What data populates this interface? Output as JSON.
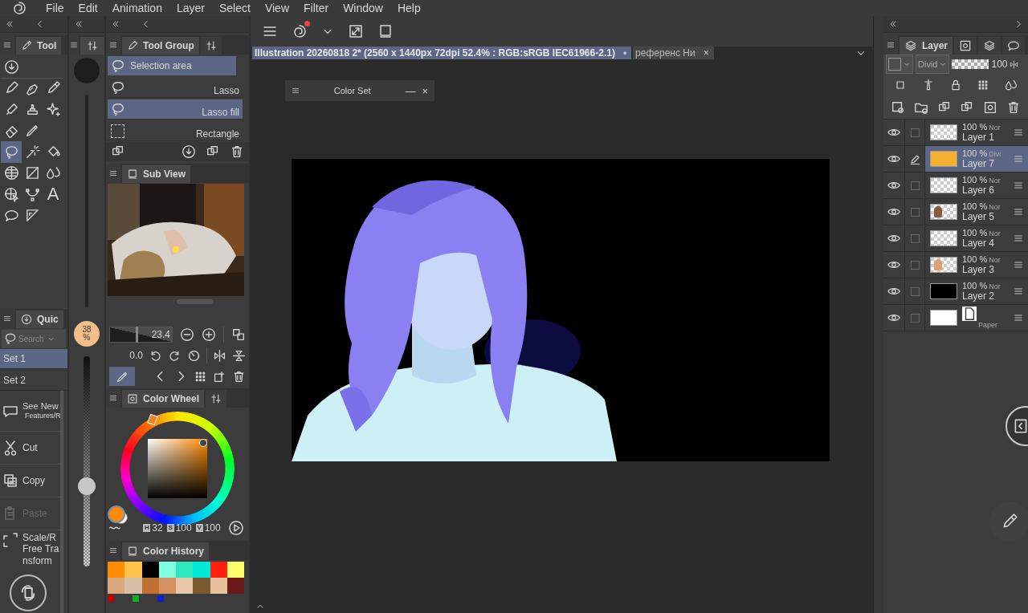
{
  "menu": [
    "File",
    "Edit",
    "Animation",
    "Layer",
    "Select",
    "View",
    "Filter",
    "Window",
    "Help"
  ],
  "tool_panel": {
    "tab": "Tool",
    "tools": [
      {
        "kind": "subtool",
        "selected": false
      },
      {
        "kind": "pen",
        "selected": false
      },
      {
        "kind": "nib",
        "selected": false
      },
      {
        "kind": "pencil",
        "selected": false
      },
      {
        "kind": "marker",
        "selected": false
      },
      {
        "kind": "stamp",
        "selected": false
      },
      {
        "kind": "sparkle",
        "selected": false
      },
      {
        "kind": "eraser",
        "selected": false
      },
      {
        "kind": "dropper",
        "selected": false
      },
      {
        "kind": "lasso",
        "selected": true
      },
      {
        "kind": "wand",
        "selected": false
      },
      {
        "kind": "bucket",
        "selected": false
      },
      {
        "kind": "grid",
        "selected": false
      },
      {
        "kind": "gradient",
        "selected": false
      },
      {
        "kind": "drops",
        "selected": false
      },
      {
        "kind": "cursor",
        "selected": false
      },
      {
        "kind": "bezier",
        "selected": false
      },
      {
        "kind": "text",
        "label": "A",
        "selected": false
      },
      {
        "kind": "bubble",
        "selected": false
      },
      {
        "kind": "ruler",
        "selected": false
      }
    ]
  },
  "brush_panel": {
    "badge_value": "38",
    "badge_unit": "%",
    "level": 0.37
  },
  "tool_group": {
    "tab": "Tool Group",
    "group": "Selection area",
    "items": [
      {
        "label": "Lasso",
        "selected": false
      },
      {
        "label": "Lasso fill",
        "selected": true
      },
      {
        "label": "Rectangle",
        "kind": "rect",
        "selected": false
      }
    ]
  },
  "sub_view": {
    "tab": "Sub View",
    "kind": "picture",
    "zoom": "23.4",
    "level": 0.42,
    "rotation": "0.0"
  },
  "quick_access": {
    "tab": "Quic",
    "search_placeholder": "Search",
    "sets": [
      {
        "label": "Set 1",
        "selected": true
      },
      {
        "label": "Set 2",
        "selected": false
      }
    ],
    "items": [
      {
        "kind": "new",
        "lines": [
          "See New",
          "Features/R"
        ],
        "disabled": false
      },
      {
        "kind": "cut",
        "lines": [
          "Cut"
        ],
        "disabled": false
      },
      {
        "kind": "copy",
        "lines": [
          "Copy"
        ],
        "disabled": false
      },
      {
        "kind": "paste",
        "lines": [
          "Paste"
        ],
        "disabled": true
      },
      {
        "kind": "transform",
        "lines": [
          "Scale/R",
          "Free Tra",
          "nsform"
        ],
        "disabled": false
      }
    ]
  },
  "color_wheel": {
    "tab": "Color Wheel",
    "hsv": [
      {
        "label": "H",
        "value": "32"
      },
      {
        "label": "S",
        "value": "100"
      },
      {
        "label": "V",
        "value": "100"
      }
    ]
  },
  "color_history": {
    "tab": "Color History",
    "swatches": [
      {
        "color": "#ff8c00"
      },
      {
        "color": "#ffc24a"
      },
      {
        "color": "#000000"
      },
      {
        "color": "#80ffe0"
      },
      {
        "color": "#2ee8c0"
      },
      {
        "color": "#00e8d8"
      },
      {
        "color": "#ff2010"
      },
      {
        "color": "#ffff70"
      },
      {
        "color": "#d9a880"
      },
      {
        "color": "#d8c0a8"
      },
      {
        "color": "#c07030"
      },
      {
        "color": "#d49060"
      },
      {
        "color": "#e8c8a8"
      },
      {
        "color": "#7a5830"
      },
      {
        "color": "#e8c0a0"
      },
      {
        "color": "#6a1818"
      }
    ],
    "dots": [
      {
        "color": "#c00000"
      },
      {
        "color": "#10b020"
      },
      {
        "color": "#1020d0"
      }
    ]
  },
  "document_tabs": [
    {
      "label": "Illustration 20260818 2* (2560 x 1440px 72dpi 52.4% : RGB:sRGB IEC61966-2.1)",
      "marker": "•",
      "selected": true
    },
    {
      "label": "референс Ни",
      "marker": "×",
      "selected": false
    }
  ],
  "color_set_panel": {
    "title": "Color Set",
    "minimize": "—",
    "close": "×"
  },
  "layer_panel": {
    "tab": "Layer",
    "blend_mode": "Divid",
    "opacity": "100",
    "level": 1,
    "layers": [
      {
        "name": "Layer 1",
        "opacity": "100 %",
        "mode": "Nor",
        "kind": "empty",
        "visible": true,
        "selected": false
      },
      {
        "name": "Layer 7",
        "opacity": "100 %",
        "mode": "Divi",
        "kind": "fill",
        "color": "#f8b030",
        "visible": true,
        "selected": true
      },
      {
        "name": "Layer 6",
        "opacity": "100 %",
        "mode": "Nor",
        "kind": "empty",
        "visible": true,
        "selected": false
      },
      {
        "name": "Layer 5",
        "opacity": "100 %",
        "mode": "Nor",
        "kind": "sketch",
        "color": "#8a5a3a",
        "visible": true,
        "selected": false
      },
      {
        "name": "Layer 4",
        "opacity": "100 %",
        "mode": "Nor",
        "kind": "empty",
        "visible": true,
        "selected": false
      },
      {
        "name": "Layer 3",
        "opacity": "100 %",
        "mode": "Nor",
        "kind": "sketch",
        "color": "#e0a070",
        "visible": true,
        "selected": false
      },
      {
        "name": "Layer 2",
        "opacity": "100 %",
        "mode": "Nor",
        "kind": "fill",
        "color": "#000000",
        "visible": true,
        "selected": false
      },
      {
        "name": "Paper",
        "kind": "paper",
        "color": "#ffffff",
        "visible": true,
        "selected": false
      }
    ]
  }
}
